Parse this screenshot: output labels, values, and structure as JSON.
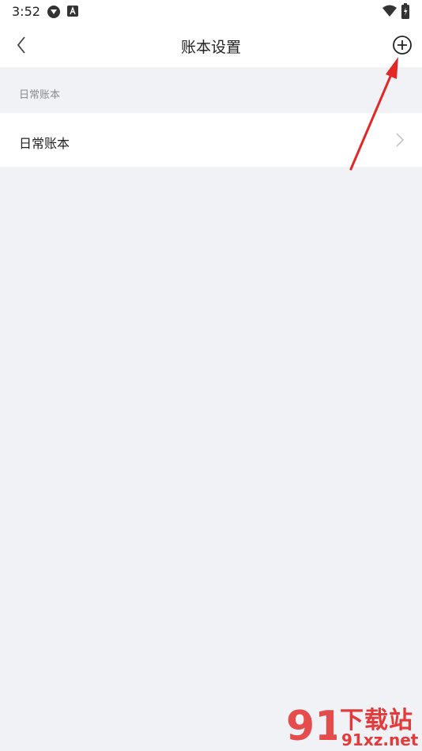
{
  "status_bar": {
    "time": "3:52",
    "icons": [
      "vpn-shield-icon",
      "app-notification-icon",
      "wifi-icon",
      "battery-charging-icon"
    ]
  },
  "nav": {
    "title": "账本设置",
    "back_icon": "chevron-left-icon",
    "add_icon": "plus-circle-icon"
  },
  "section": {
    "header": "日常账本"
  },
  "list": {
    "items": [
      {
        "label": "日常账本",
        "icon": "chevron-right-icon"
      }
    ]
  },
  "watermark": {
    "title": "下载站",
    "site": "91xz.net"
  },
  "colors": {
    "background": "#f1f2f6",
    "surface": "#ffffff",
    "annotation_arrow": "#e32626"
  }
}
